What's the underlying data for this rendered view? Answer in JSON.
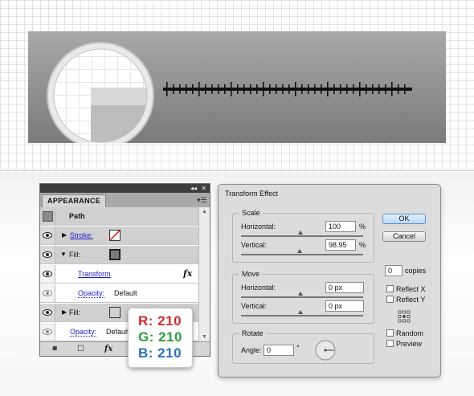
{
  "appearance_panel": {
    "title": "APPEARANCE",
    "collapse_glyph": "◂◂",
    "close_glyph": "✕",
    "menu_glyph": "▾☰",
    "object_label": "Path",
    "rows": {
      "stroke_label": "Stroke:",
      "fill1_label": "Fill:",
      "transform_label": "Transform",
      "fx_glyph": "fx",
      "opacity1_label": "Opacity:",
      "opacity1_value": "Default",
      "fill2_label": "Fill:",
      "opacity2_label": "Opacity:",
      "opacity2_value": "Default"
    },
    "footer": {
      "fx_glyph": "fx"
    },
    "fill1_swatch_color": "#7a7a7a",
    "fill2_swatch_color": "#d2d2d2"
  },
  "rgb_card": {
    "r": "R: 210",
    "g": "G: 210",
    "b": "B: 210",
    "colors": {
      "r": "#d42a2a",
      "g": "#2e9e3e",
      "b": "#2a6fc0"
    }
  },
  "transform_dialog": {
    "title": "Transform Effect",
    "scale": {
      "label": "Scale",
      "horizontal_label": "Horizontal:",
      "horizontal_value": "100",
      "horizontal_unit": "%",
      "vertical_label": "Vertical:",
      "vertical_value": "98.95",
      "vertical_unit": "%"
    },
    "move": {
      "label": "Move",
      "horizontal_label": "Horizontal:",
      "horizontal_value": "0 px",
      "vertical_label": "Vertical:",
      "vertical_value": "0 px"
    },
    "rotate": {
      "label": "Rotate",
      "angle_label": "Angle:",
      "angle_value": "0",
      "angle_unit": "°"
    },
    "ok_label": "OK",
    "cancel_label": "Cancel",
    "copies_value": "0",
    "copies_label": "copies",
    "reflect_x_label": "Reflect X",
    "reflect_y_label": "Reflect Y",
    "random_label": "Random",
    "preview_label": "Preview"
  }
}
